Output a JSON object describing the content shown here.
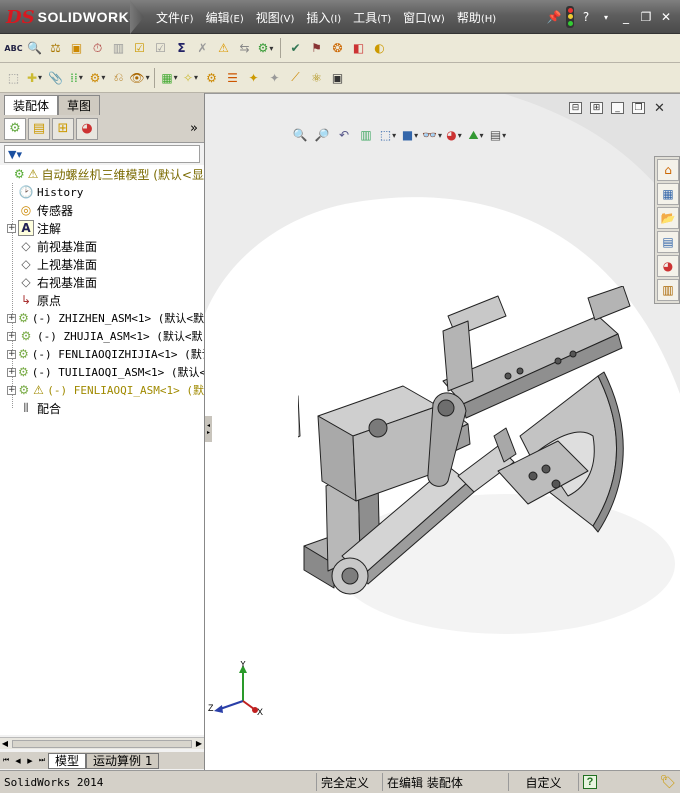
{
  "app": {
    "logo_mark": "DS",
    "logo_text": "SOLIDWORKS"
  },
  "menu": [
    {
      "label": "文件",
      "key": "(F)"
    },
    {
      "label": "编辑",
      "key": "(E)"
    },
    {
      "label": "视图",
      "key": "(V)"
    },
    {
      "label": "插入",
      "key": "(I)"
    },
    {
      "label": "工具",
      "key": "(T)"
    },
    {
      "label": "窗口",
      "key": "(W)"
    },
    {
      "label": "帮助",
      "key": "(H)"
    }
  ],
  "title_icons": [
    "pin-icon",
    "traffic-light-icon",
    "help-icon",
    "minimize-icon",
    "restore-icon",
    "close-icon"
  ],
  "panel": {
    "tabs": [
      "装配体",
      "草图"
    ],
    "icon_tabs": [
      "feature-manager-icon",
      "property-manager-icon",
      "configuration-manager-icon",
      "display-manager-icon"
    ],
    "more_label": "»",
    "filter_icon": "filter-icon"
  },
  "tree": [
    {
      "label": "自动螺丝机三维模型  (默认<显",
      "icon": "assembly-icon",
      "warning": true,
      "expand": "",
      "level": 0,
      "mono": false,
      "color": "#7a6a00"
    },
    {
      "label": "History",
      "icon": "history-icon",
      "expand": "",
      "level": 1,
      "mono": true
    },
    {
      "label": "传感器",
      "icon": "sensor-icon",
      "expand": "",
      "level": 1,
      "mono": false
    },
    {
      "label": "注解",
      "icon": "annotation-icon",
      "expand": "+",
      "level": 1,
      "mono": false
    },
    {
      "label": "前视基准面",
      "icon": "plane-icon",
      "expand": "",
      "level": 1,
      "mono": false
    },
    {
      "label": "上视基准面",
      "icon": "plane-icon",
      "expand": "",
      "level": 1,
      "mono": false
    },
    {
      "label": "右视基准面",
      "icon": "plane-icon",
      "expand": "",
      "level": 1,
      "mono": false
    },
    {
      "label": "原点",
      "icon": "origin-icon",
      "expand": "",
      "level": 1,
      "mono": false
    },
    {
      "label": "(-) ZHIZHEN_ASM<1> (默认<默",
      "icon": "subassembly-icon",
      "expand": "+",
      "level": 1,
      "mono": true
    },
    {
      "label": "(-) ZHUJIA_ASM<1> (默认<默",
      "icon": "subassembly-icon",
      "expand": "+",
      "level": 1,
      "mono": true
    },
    {
      "label": "(-) FENLIAOQIZHIJIA<1> (默认",
      "icon": "subassembly-icon",
      "expand": "+",
      "level": 1,
      "mono": true
    },
    {
      "label": "(-) TUILIAOQI_ASM<1> (默认<",
      "icon": "subassembly-icon",
      "expand": "+",
      "level": 1,
      "mono": true
    },
    {
      "label": "(-) FENLIAOQI_ASM<1> (默",
      "icon": "subassembly-icon",
      "warning": true,
      "expand": "+",
      "level": 1,
      "mono": true,
      "color": "#a08a00"
    },
    {
      "label": "配合",
      "icon": "mates-icon",
      "expand": "",
      "level": 1,
      "mono": false
    }
  ],
  "bottom_tabs": [
    "模型",
    "运动算例 1"
  ],
  "status": {
    "app_version": "SolidWorks 2014",
    "definition": "完全定义",
    "mode": "在编辑 装配体",
    "units": "自定义"
  },
  "viewport": {
    "triad_x": "X",
    "triad_y": "Y",
    "triad_z": "Z",
    "accent_bg": "#e9e9e9"
  }
}
